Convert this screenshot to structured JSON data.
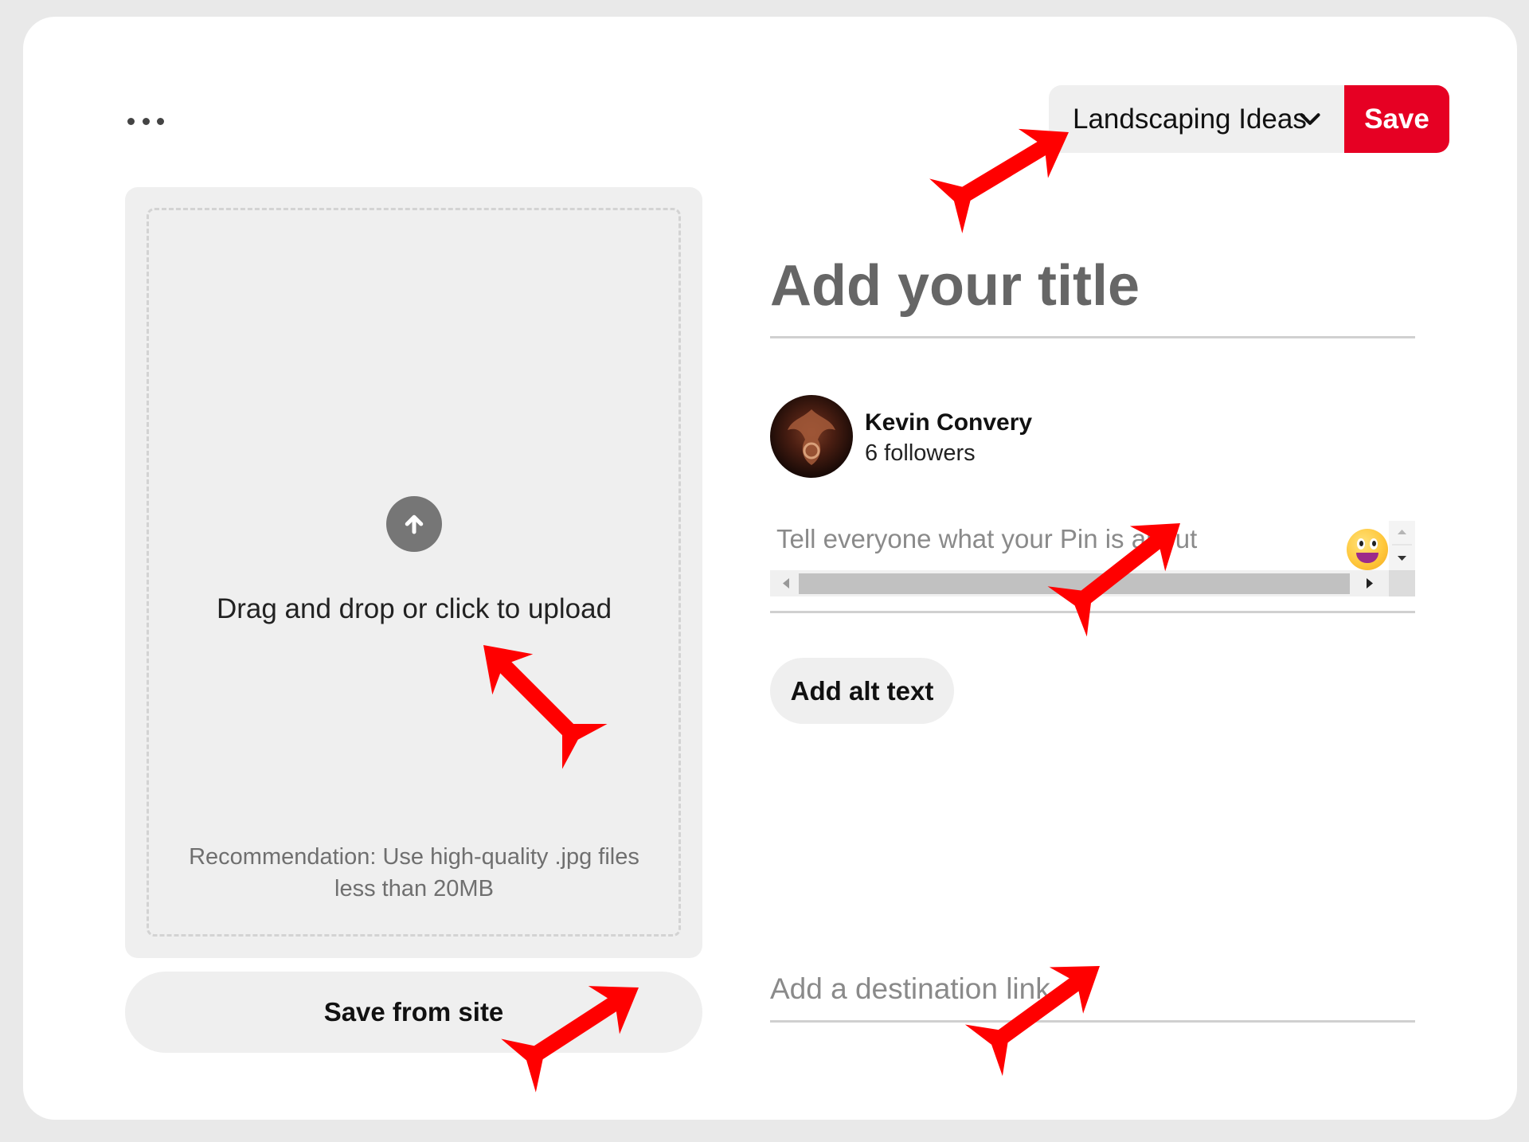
{
  "board_select": {
    "selected": "Landscaping Ideas",
    "save_label": "Save"
  },
  "upload": {
    "instruction": "Drag and drop or click to upload",
    "recommendation": "Recommendation: Use high-quality .jpg files less than 20MB",
    "save_from_site_label": "Save from site"
  },
  "pin": {
    "title_placeholder": "Add your title",
    "description_placeholder": "Tell everyone what your Pin is about",
    "alt_text_label": "Add alt text",
    "link_placeholder": "Add a destination link"
  },
  "user": {
    "name": "Kevin Convery",
    "followers": "6 followers"
  },
  "colors": {
    "brand_red": "#e60023",
    "annotation_arrow": "#ff0000"
  },
  "icons": [
    "more-icon",
    "chevron-down-icon",
    "upload-arrow-icon",
    "emoji-icon"
  ]
}
